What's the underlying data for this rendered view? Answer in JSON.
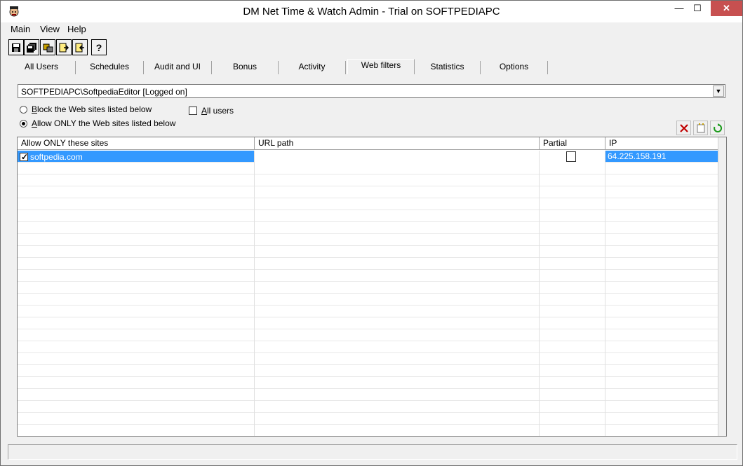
{
  "window": {
    "title": "DM Net Time & Watch Admin - Trial on SOFTPEDIAPC",
    "min_label": "—",
    "max_label": "☐",
    "close_label": "✕"
  },
  "menu": [
    "Main",
    "View",
    "Help"
  ],
  "toolbar_icons": [
    "save-icon",
    "save-all-icon",
    "tools-icon",
    "export-icon",
    "import-icon",
    "help-icon"
  ],
  "tabs": [
    "All Users",
    "Schedules",
    "Audit and UI",
    "Bonus",
    "Activity",
    "Web filters",
    "Statistics",
    "Options"
  ],
  "active_tab": "Web filters",
  "user_select": {
    "value": "SOFTPEDIAPC\\SoftpediaEditor  [Logged on]"
  },
  "filter_mode": {
    "block_label_u": "B",
    "block_label_rest": "lock the Web sites listed below",
    "allow_label_u": "A",
    "allow_label_rest": "llow ONLY the Web sites listed below",
    "selected": "allow"
  },
  "all_users": {
    "label_u": "A",
    "label_rest": "ll users",
    "checked": false
  },
  "actions": [
    "delete-icon",
    "new-icon",
    "refresh-icon"
  ],
  "table": {
    "columns": [
      "Allow ONLY these sites",
      "URL path",
      "Partial",
      "IP"
    ],
    "rows": [
      {
        "site": "softpedia.com",
        "checked": true,
        "url_path": "",
        "partial": false,
        "ip": "64.225.158.191"
      }
    ]
  },
  "colors": {
    "selection": "#3399ff",
    "close_button": "#c75050"
  }
}
